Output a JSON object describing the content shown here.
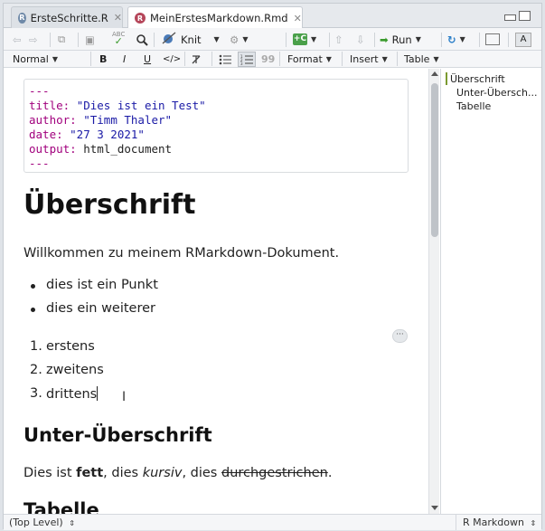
{
  "tabs": [
    {
      "label": "ErsteSchritte.R",
      "icon": "r-file-icon",
      "active": false
    },
    {
      "label": "MeinErstesMarkdown.Rmd",
      "icon": "rmd-file-icon",
      "active": true
    }
  ],
  "toolbar": {
    "spellcheck_label": "ABC",
    "knit_label": "Knit",
    "run_label": "Run",
    "format_style": "Normal",
    "bold": "B",
    "italic": "I",
    "underline": "U",
    "code": "</>",
    "format_label": "Format",
    "insert_label": "Insert",
    "table_label": "Table",
    "quote": "99"
  },
  "yaml": {
    "lines": [
      {
        "key": "---",
        "value": ""
      },
      {
        "key": "title: ",
        "value": "\"Dies ist ein Test\""
      },
      {
        "key": "author: ",
        "value": "\"Timm Thaler\""
      },
      {
        "key": "date: ",
        "value": "\"27 3 2021\""
      },
      {
        "key": "output: ",
        "value": "html_document"
      },
      {
        "key": "---",
        "value": ""
      }
    ]
  },
  "document": {
    "heading1": "Überschrift",
    "intro": "Willkommen zu meinem RMarkdown-Dokument.",
    "bullets": [
      "dies ist ein Punkt",
      "dies ein weiterer"
    ],
    "numbered": [
      {
        "num": "1.",
        "text": "erstens"
      },
      {
        "num": "2.",
        "text": "zweitens"
      },
      {
        "num": "3.",
        "text": "drittens"
      }
    ],
    "ellipsis": "···",
    "heading2": "Unter-Überschrift",
    "formatted": {
      "pre": "Dies ist ",
      "bold": "fett",
      "mid1": ", dies ",
      "italic": "kursiv",
      "mid2": ", dies ",
      "strike": "durchgestrichen",
      "end": "."
    },
    "heading3": "Tabelle"
  },
  "outline": [
    "Überschrift",
    "Unter-Übersch...",
    "Tabelle"
  ],
  "status": {
    "left": "(Top Level)",
    "right": "R Markdown"
  },
  "colors": {
    "accent": "#7b9a30",
    "yaml_key": "#a1007d",
    "yaml_string": "#1a1aa6"
  }
}
